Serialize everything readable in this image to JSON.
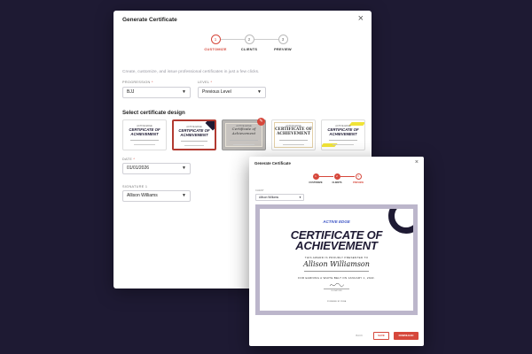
{
  "main_dialog": {
    "title": "Generate Certificate",
    "steps": [
      {
        "number": "1",
        "label": "CUSTOMIZE"
      },
      {
        "number": "2",
        "label": "CLIENTS"
      },
      {
        "number": "3",
        "label": "PREVIEW"
      }
    ],
    "active_step": 1,
    "intro": "Create, customize, and issue professional certificates in just a few clicks.",
    "progression": {
      "label": "PROGRESSION",
      "value": "BJJ"
    },
    "level": {
      "label": "LEVEL",
      "value": "Previous Level"
    },
    "design_heading": "Select certificate design",
    "designs": [
      {
        "top": "ACTIVE EDGE",
        "title": "CERTIFICATE OF ACHIEVEMENT"
      },
      {
        "top": "ACTIVE EDGE",
        "title": "CERTIFICATE OF ACHIEVEMENT",
        "selected": true
      },
      {
        "top": "ACTIVE EDGE",
        "title": "Certificate of Achievement"
      },
      {
        "top": "ACTIVE EDGE",
        "title": "CERTIFICATE OF ACHIEVEMENT"
      },
      {
        "top": "ACTIVE EDGE",
        "title": "CERTIFICATE OF ACHIEVEMENT"
      }
    ],
    "date": {
      "label": "DATE",
      "value": "01/01/2026"
    },
    "signature": {
      "label": "SIGNATURE 1",
      "value": "Allison Williams"
    }
  },
  "preview_dialog": {
    "title": "Generate Certificate",
    "steps": [
      {
        "number": "1",
        "label": "CUSTOMIZE"
      },
      {
        "number": "2",
        "label": "CLIENTS"
      },
      {
        "number": "3",
        "label": "PREVIEW"
      }
    ],
    "client_label": "CLIENT",
    "client_value": "Allison Williams",
    "certificate": {
      "logo": "ACTIVE EDGE",
      "heading_line1": "CERTIFICATE OF",
      "heading_line2": "ACHIEVEMENT",
      "presented": "THIS AWARD IS PROUDLY PRESENTED TO",
      "recipient": "Allison Williamson",
      "reason": "FOR EARNING A WHITE BELT ON JANUARY 1, 2022.",
      "signature_caption": "SIGNATURE",
      "powered": "POWERED BY ZURA"
    },
    "buttons": {
      "back": "BACK",
      "save": "SAVE",
      "download": "DOWNLOAD"
    }
  },
  "colors": {
    "accent": "#d6473b",
    "navy": "#1e1a33",
    "backdrop": "#1e1a33"
  }
}
